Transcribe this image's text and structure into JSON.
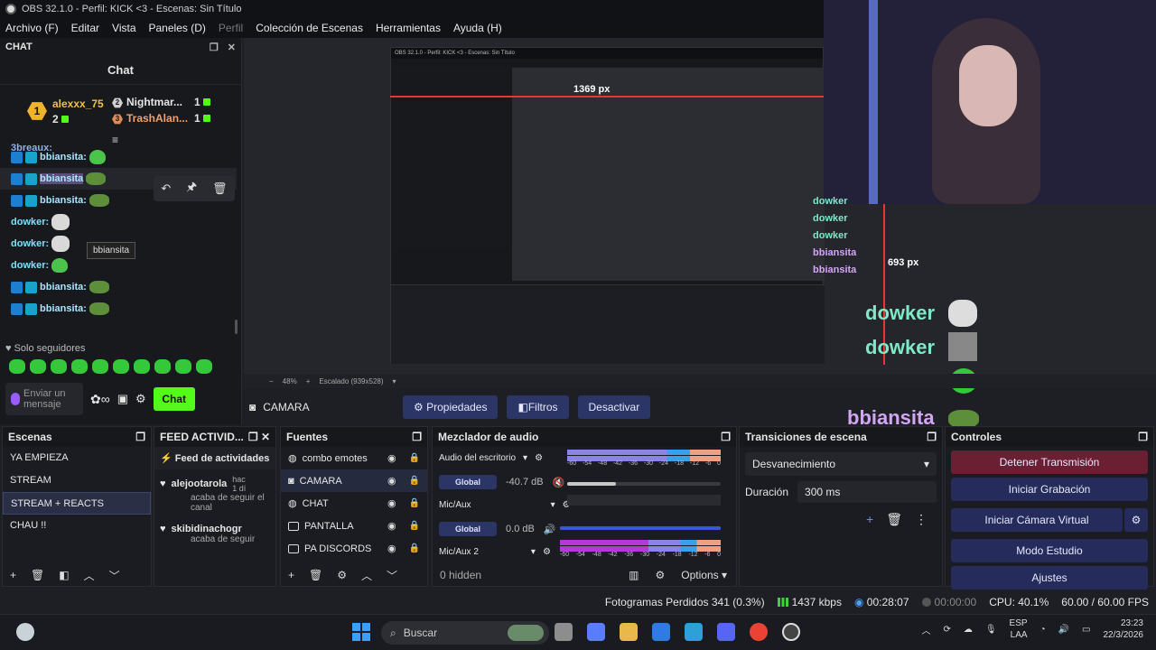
{
  "window": {
    "title": "OBS 32.1.0 - Perfil: KICK <3 - Escenas: Sin Título"
  },
  "menu": [
    "Archivo (F)",
    "Editar",
    "Vista",
    "Paneles (D)",
    "Perfil",
    "Colección de Escenas",
    "Herramientas",
    "Ayuda (H)"
  ],
  "chat": {
    "dock_title": "CHAT",
    "title": "Chat",
    "leaderboard": [
      {
        "rank": "1",
        "name": "alexxx_75",
        "count": "2"
      },
      {
        "rank": "2",
        "name": "Nightmar...",
        "count": "1"
      },
      {
        "rank": "3",
        "name": "TrashAlan...",
        "count": "1"
      }
    ],
    "partial_first": "3breaux:",
    "messages": [
      {
        "user": "bbiansita:",
        "emote": "green"
      },
      {
        "user": "bbiansita",
        "emote": "frog"
      },
      {
        "user": "bbiansita:",
        "emote": "frog"
      },
      {
        "user": "dowker:",
        "emote": "cat"
      },
      {
        "user": "dowker:",
        "emote": "cat"
      },
      {
        "user": "dowker:",
        "emote": "green"
      },
      {
        "user": "bbiansita:",
        "emote": "frog"
      },
      {
        "user": "bbiansita:",
        "emote": "frog"
      }
    ],
    "tooltip": "bbiansita",
    "followers_only": "Solo seguidores",
    "input_placeholder": "Enviar un mensaje",
    "send_label": "Chat",
    "icons": {
      "undo": "↶",
      "pin": "🖈",
      "trash": "🗑"
    }
  },
  "preview": {
    "nested_title": "OBS 32.1.0 - Perfil: KICK <3 - Escenas: Sin Título",
    "ruler_h_label": "1369 px",
    "ruler_v_label": "693 px",
    "overlay": [
      {
        "user": "dowker",
        "kind": "d"
      },
      {
        "user": "dowker",
        "kind": "d"
      },
      {
        "user": "dowker",
        "kind": "d"
      },
      {
        "user": "bbiansita",
        "kind": "b"
      },
      {
        "user": "bbiansita",
        "kind": "b"
      }
    ],
    "small_overlay": [
      "dowker",
      "dowker",
      "dowker",
      "bbiansita",
      "bbiansita"
    ]
  },
  "zoom": {
    "value": "48%",
    "scaling": "Escalado (939x528)"
  },
  "source_toolbar": {
    "source": "CAMARA",
    "properties": "Propiedades",
    "filters": "Filtros",
    "deactivate": "Desactivar"
  },
  "scenes": {
    "title": "Escenas",
    "items": [
      "YA EMPIEZA",
      "STREAM",
      "STREAM + REACTS",
      "CHAU !!"
    ],
    "selected": 2
  },
  "feed": {
    "title": "FEED ACTIVID...",
    "header": "Feed de actividades",
    "events": [
      {
        "user": "alejootarola",
        "time": "hac 1 dí",
        "text": "acaba de seguir el canal"
      },
      {
        "user": "skibidinachogr",
        "time": "",
        "text": "acaba de seguir"
      }
    ]
  },
  "sources": {
    "title": "Fuentes",
    "items": [
      "combo emotes",
      "CAMARA",
      "CHAT",
      "PANTALLA",
      "PA DISCORDS"
    ],
    "selected": 1
  },
  "mixer": {
    "title": "Mezclador de audio",
    "channels": [
      {
        "name": "Audio del escritorio",
        "route": "Global",
        "db": "-40.7 dB",
        "muted": true,
        "level": 0.32
      },
      {
        "name": "Mic/Aux",
        "route": "Global",
        "db": "0.0 dB",
        "muted": false,
        "level": 1.0
      },
      {
        "name": "Mic/Aux 2",
        "route": "",
        "db": "",
        "muted": false,
        "level": 0.0
      }
    ],
    "scale": [
      "-60",
      "-54",
      "-48",
      "-42",
      "-36",
      "-30",
      "-24",
      "-18",
      "-12",
      "-6",
      "0"
    ],
    "hidden": "0 hidden",
    "options": "Options"
  },
  "transitions": {
    "title": "Transiciones de escena",
    "type": "Desvanecimiento",
    "duration_label": "Duración",
    "duration": "300 ms"
  },
  "controls": {
    "title": "Controles",
    "buttons": [
      "Detener Transmisión",
      "Iniciar Grabación",
      "Iniciar Cámara Virtual",
      "Modo Estudio",
      "Ajustes"
    ]
  },
  "status": {
    "dropped": "Fotogramas Perdidos 341 (0.3%)",
    "bitrate": "1437 kbps",
    "stream_time": "00:28:07",
    "rec_time": "00:00:00",
    "cpu": "CPU: 40.1%",
    "fps": "60.00 / 60.00 FPS"
  },
  "taskbar": {
    "search": "Buscar",
    "lang1": "ESP",
    "lang2": "LAA",
    "time": "23:23",
    "date": "22/3/2026"
  },
  "colors": {
    "accent_green": "#53fc18",
    "blue_button": "#2b3566",
    "red_button": "#6b1f33"
  }
}
